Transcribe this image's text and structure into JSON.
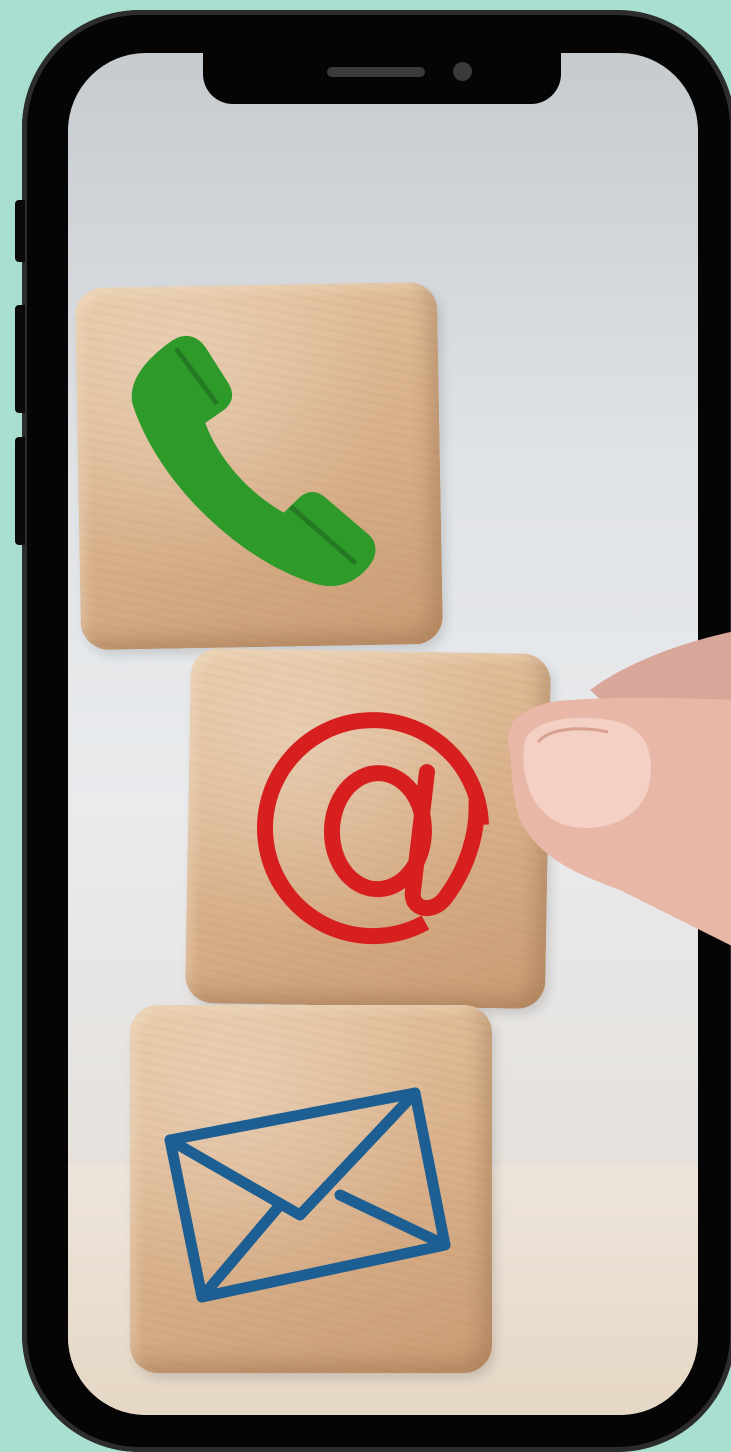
{
  "image": {
    "subject": "phone-mockup-contact-blocks",
    "icons": [
      "phone-icon",
      "at-sign-icon",
      "envelope-icon"
    ],
    "colors": {
      "background": "#a8dfd0",
      "phone_frame": "#050505",
      "phone_icon": "#2e9a2a",
      "at_icon": "#d71f1f",
      "envelope_icon": "#1e5f93",
      "wood": "#d9b18b"
    }
  }
}
